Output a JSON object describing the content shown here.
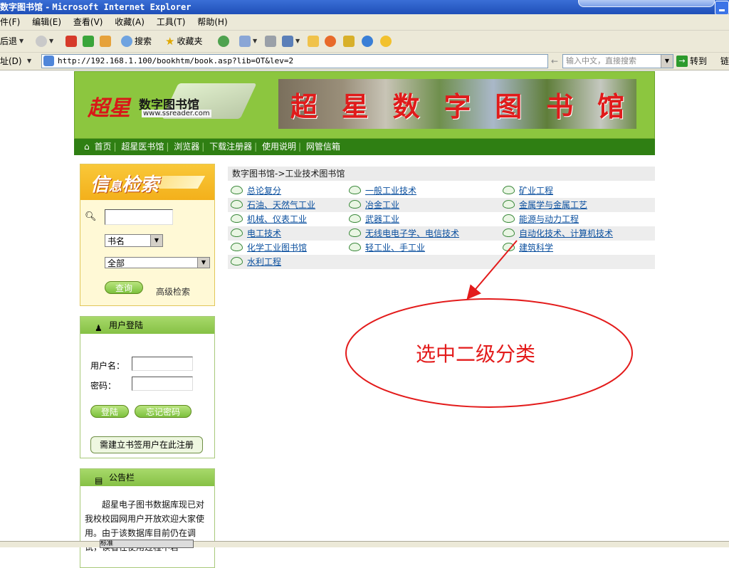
{
  "window": {
    "title_cn": "数字图书馆",
    "title_sep": " - ",
    "title_app": "Microsoft Internet Explorer"
  },
  "menubar": [
    "件(F)",
    "编辑(E)",
    "查看(V)",
    "收藏(A)",
    "工具(T)",
    "帮助(H)"
  ],
  "toolbar": {
    "back_label": "后退",
    "search_label": "搜索",
    "favorites_label": "收藏夹"
  },
  "addressbar": {
    "label": "址(D)",
    "url": "http://192.168.1.100/bookhtm/book.asp?lib=OT&lev=2",
    "search_hint": "输入中文，直接搜索",
    "go_label": "转到",
    "links_label": "链"
  },
  "banner": {
    "logo_mark": "超星",
    "logo_cn": "数字图书馆",
    "logo_url": "www.ssreader.com",
    "photo_text": [
      "超",
      "星",
      "数",
      "字",
      "图",
      "书",
      "馆"
    ]
  },
  "nav": {
    "home_icon_glyph": "⌂",
    "items": [
      "首页",
      "超星医书馆",
      "浏览器",
      "下载注册器",
      "使用说明",
      "网管信箱"
    ]
  },
  "search_panel": {
    "title_big": "信",
    "title_small": "息",
    "title_rest": "检索",
    "keyword_value": "",
    "field_select": "书名",
    "scope_select": "全部",
    "query_button": "查询",
    "advanced_link": "高级检索"
  },
  "login_panel": {
    "title": "用户登陆",
    "username_label": "用户名：",
    "password_label": "密码：",
    "login_button": "登陆",
    "forgot_button": "忘记密码",
    "register_button": "需建立书签用户在此注册"
  },
  "notice_panel": {
    "title": "公告栏",
    "text": "超星电子图书数据库现已对我校校园网用户开放欢迎大家使用。由于该数据库目前仍在调试，读者在使用过程中若"
  },
  "breadcrumb": "数字图书馆->工业技术图书馆",
  "categories": {
    "col1": [
      "总论复分",
      "石油、天然气工业",
      "机械、仪表工业",
      "电工技术",
      "化学工业图书馆",
      "水利工程"
    ],
    "col2": [
      "一般工业技术",
      "冶金工业",
      "武器工业",
      "无线电电子学、电信技术",
      "轻工业、手工业"
    ],
    "col3": [
      "矿业工程",
      "金属学与金属工艺",
      "能源与动力工程",
      "自动化技术、计算机技术",
      "建筑科学"
    ]
  },
  "annotation": {
    "text": "选中二级分类",
    "color": "#e31b1b"
  },
  "taskbar_fragment": "标准"
}
